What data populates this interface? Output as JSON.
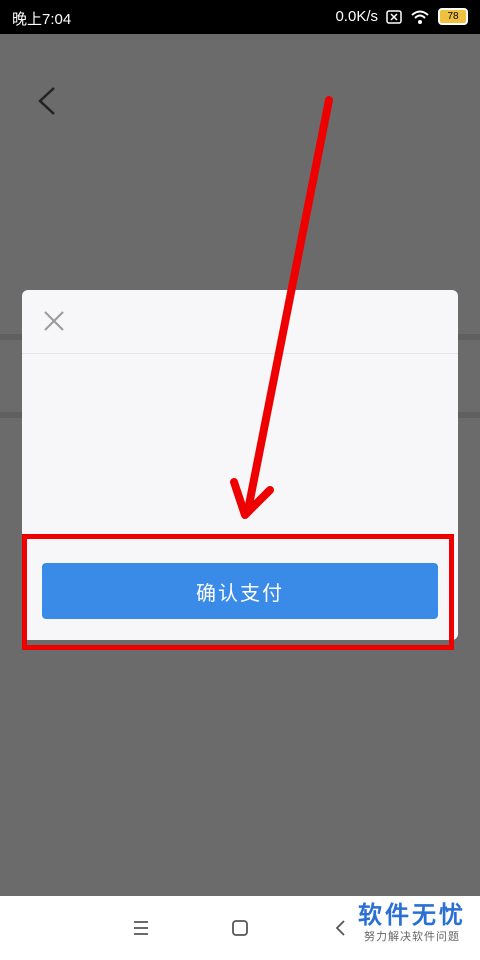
{
  "status_bar": {
    "time": "晚上7:04",
    "net_speed": "0.0K/s",
    "battery_level": "78"
  },
  "dialog": {
    "confirm_pay_label": "确认支付"
  },
  "watermark": {
    "title": "软件无忧",
    "subtitle": "努力解决软件问题"
  },
  "colors": {
    "primary_button": "#3a8be8",
    "annotation_red": "#e00000",
    "overlay": "#6b6b6b"
  },
  "icons": [
    "back-icon",
    "close-icon",
    "wifi-icon",
    "sim-icon",
    "battery-icon",
    "menu-icon",
    "home-icon",
    "nav-back-icon"
  ]
}
